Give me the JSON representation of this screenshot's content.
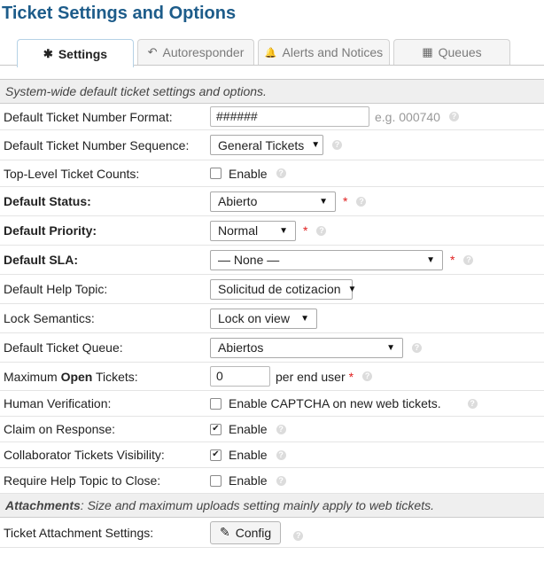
{
  "page": {
    "title": "Ticket Settings and Options"
  },
  "tabs": [
    {
      "label": "Settings",
      "icon": "asterisk-icon",
      "glyph": "✱",
      "active": true
    },
    {
      "label": "Autoresponder",
      "icon": "reply-icon",
      "glyph": "↶",
      "active": false
    },
    {
      "label": "Alerts and Notices",
      "icon": "bell-icon",
      "glyph": "🔔",
      "active": false
    },
    {
      "label": "Queues",
      "icon": "table-icon",
      "glyph": "▦",
      "active": false
    }
  ],
  "sections": {
    "system": "System-wide default ticket settings and options.",
    "attachments_title": "Attachments",
    "attachments_desc": ": Size and maximum uploads setting mainly apply to web tickets."
  },
  "fields": {
    "number_format": {
      "label": "Default Ticket Number Format:",
      "value": "######",
      "hint": "e.g. 000740"
    },
    "number_sequence": {
      "label": "Default Ticket Number Sequence:",
      "value": "General Tickets"
    },
    "top_level_counts": {
      "label": "Top-Level Ticket Counts:",
      "checkbox_label": "Enable",
      "checked": false
    },
    "default_status": {
      "label": "Default Status:",
      "value": "Abierto"
    },
    "default_priority": {
      "label": "Default Priority:",
      "value": "Normal"
    },
    "default_sla": {
      "label": "Default SLA:",
      "value": "— None —"
    },
    "help_topic": {
      "label": "Default Help Topic:",
      "value": "Solicitud de cotizacion"
    },
    "lock_semantics": {
      "label": "Lock Semantics:",
      "value": "Lock on view"
    },
    "ticket_queue": {
      "label": "Default Ticket Queue:",
      "value": "Abiertos"
    },
    "max_open": {
      "label_pre": "Maximum ",
      "label_bold": "Open",
      "label_post": " Tickets:",
      "value": "0",
      "after": "per end user"
    },
    "human_verification": {
      "label": "Human Verification:",
      "checkbox_label": "Enable CAPTCHA on new web tickets.",
      "checked": false
    },
    "claim_on_response": {
      "label": "Claim on Response:",
      "checkbox_label": "Enable",
      "checked": true
    },
    "collaborator_visibility": {
      "label": "Collaborator Tickets Visibility:",
      "checkbox_label": "Enable",
      "checked": true
    },
    "require_help_topic": {
      "label": "Require Help Topic to Close:",
      "checkbox_label": "Enable",
      "checked": false
    },
    "attachment_settings": {
      "label": "Ticket Attachment Settings:",
      "button": "Config",
      "button_icon": "edit-icon"
    }
  },
  "ui": {
    "required_mark": "*",
    "help_glyph": "?",
    "check_glyph": "✔",
    "select_arrow": "▼",
    "edit_glyph": "✎"
  },
  "colors": {
    "title": "#1d5c8a",
    "required": "#e02020",
    "section_bg": "#efefef"
  }
}
